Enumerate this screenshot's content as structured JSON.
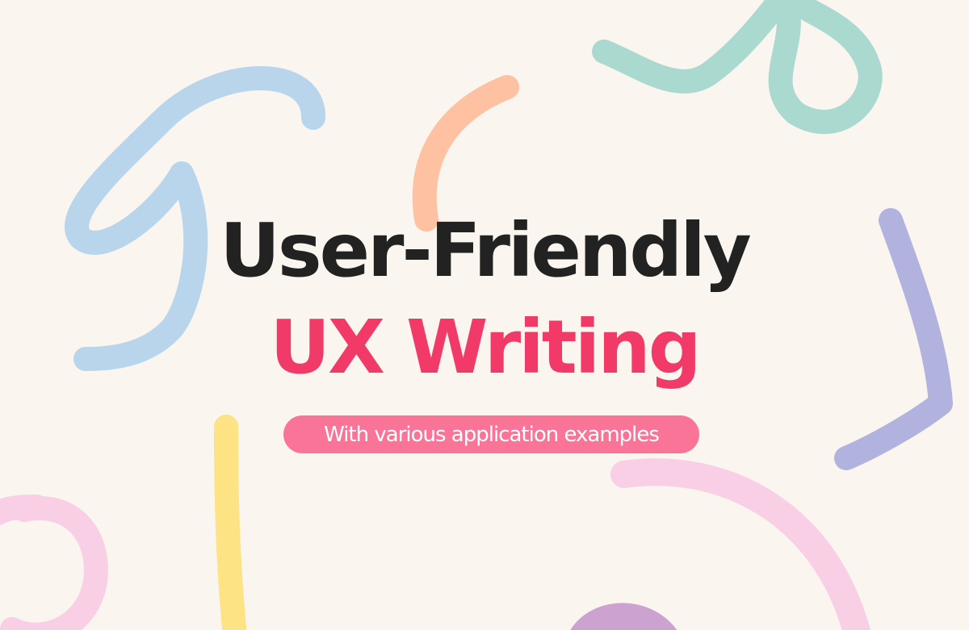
{
  "banner": {
    "title_line1": "User-Friendly",
    "title_line2": "UX Writing",
    "subtitle": "With various application examples"
  },
  "colors": {
    "background": "#faf5ef",
    "title_dark": "#222222",
    "title_accent": "#f23a68",
    "pill_background": "#fa7497",
    "pill_text": "#ffffff",
    "squiggle_blue": "#b8d5ec",
    "squiggle_teal": "#a9d9cf",
    "squiggle_orange": "#fec1a2",
    "squiggle_purple": "#b1b2dd",
    "squiggle_yellow": "#fde383",
    "squiggle_pink": "#f9cfe5",
    "squiggle_violet": "#cba2d0"
  },
  "decorations": [
    "blue-squiggle",
    "teal-squiggle",
    "orange-arc",
    "purple-boomerang",
    "yellow-line",
    "pink-circle",
    "pink-arc",
    "violet-blob"
  ]
}
